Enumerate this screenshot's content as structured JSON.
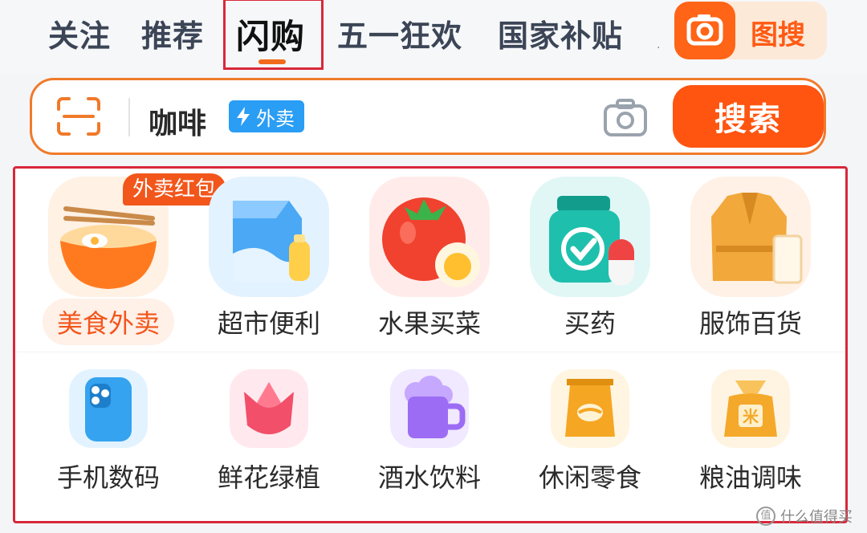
{
  "tabs": [
    {
      "label": "关注"
    },
    {
      "label": "推荐"
    },
    {
      "label": "闪购"
    },
    {
      "label": "五一狂欢"
    },
    {
      "label": "国家补贴"
    }
  ],
  "tab_active_index": 2,
  "tab_overflow": ".",
  "image_search": {
    "label": "图搜",
    "icon": "camera-icon"
  },
  "search": {
    "query": "咖啡",
    "badge": "外卖",
    "badge_icon": "lightning-icon",
    "button": "搜索",
    "icons": [
      "scan-icon",
      "camera-icon"
    ]
  },
  "categories": [
    {
      "label": "美食外卖",
      "icon": "noodle-bowl-icon",
      "promo": "外卖红包"
    },
    {
      "label": "超市便利",
      "icon": "milk-carton-icon"
    },
    {
      "label": "水果买菜",
      "icon": "tomato-egg-icon"
    },
    {
      "label": "买药",
      "icon": "medicine-bottle-icon"
    },
    {
      "label": "服饰百货",
      "icon": "coat-icon"
    },
    {
      "label": "手机数码",
      "icon": "phone-icon"
    },
    {
      "label": "鲜花绿植",
      "icon": "tulip-icon"
    },
    {
      "label": "酒水饮料",
      "icon": "beer-mug-icon"
    },
    {
      "label": "休闲零食",
      "icon": "snack-bag-icon"
    },
    {
      "label": "粮油调味",
      "icon": "rice-sack-icon"
    }
  ],
  "watermark": {
    "text": "什么值得买",
    "icon_char": "值"
  },
  "colors": {
    "accent": "#ff5511",
    "highlight_box": "#d8283a",
    "badge_blue": "#2a9df4"
  }
}
